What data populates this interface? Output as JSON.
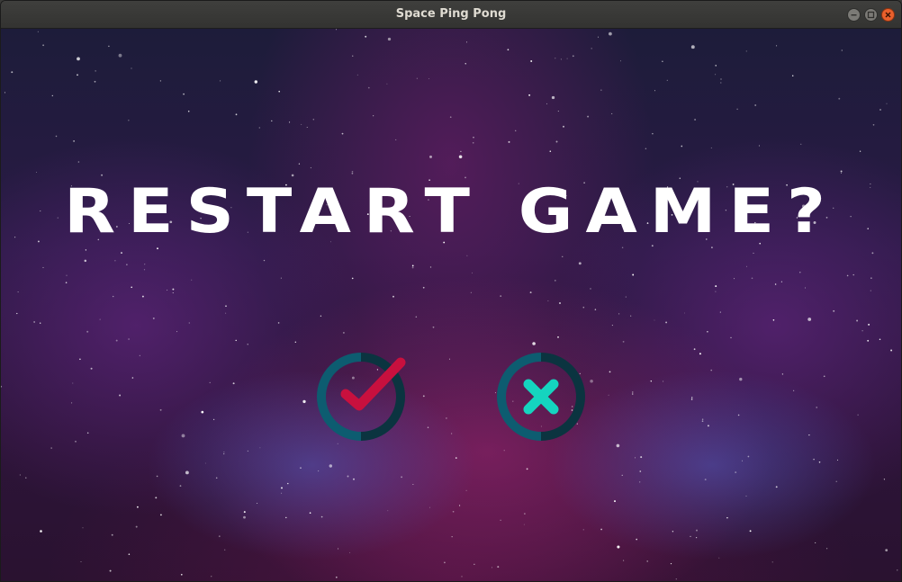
{
  "window": {
    "title": "Space Ping Pong",
    "controls": [
      "minimize-icon",
      "maximize-icon",
      "close-icon"
    ]
  },
  "dialog": {
    "prompt": "RESTART GAME?",
    "confirm": {
      "icon": "checkmark-icon",
      "color": "#c8103e",
      "ring_colors": [
        "#0d5c70",
        "#0b3440"
      ]
    },
    "cancel": {
      "icon": "x-icon",
      "color": "#15d4bf",
      "ring_colors": [
        "#0d5c70",
        "#0b3440"
      ]
    }
  },
  "colors": {
    "titlebar": "#3a3a38",
    "close_button": "#e9602c",
    "text": "#ffffff"
  }
}
